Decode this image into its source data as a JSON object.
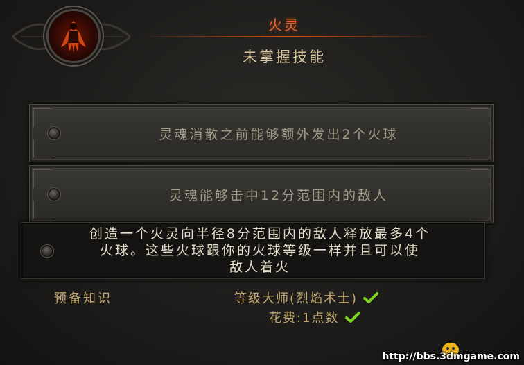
{
  "skill": {
    "name": "火灵",
    "status": "未掌握技能"
  },
  "runes": [
    {
      "text": "灵魂消散之前能够额外发出2个火球"
    },
    {
      "text": "灵魂能够击中12分范围内的敌人"
    }
  ],
  "tooltip": {
    "line1": "创造一个火灵向半径8分范围内的敌人释放最多4个",
    "line2": "火球。这些火球跟你的火球等级一样并且可以使",
    "line3": "敌人着火"
  },
  "prerequisites": {
    "label": "预备知识",
    "requirement": "等级大师(烈焰术士)",
    "cost": "花费:1点数"
  },
  "watermark": "http://bbs.3dmgame.com",
  "colors": {
    "title": "#e8662a",
    "status": "#d8c7a1",
    "rune_text": "#a39a88",
    "requirement": "#c2a86f",
    "check": "#7ed321"
  }
}
